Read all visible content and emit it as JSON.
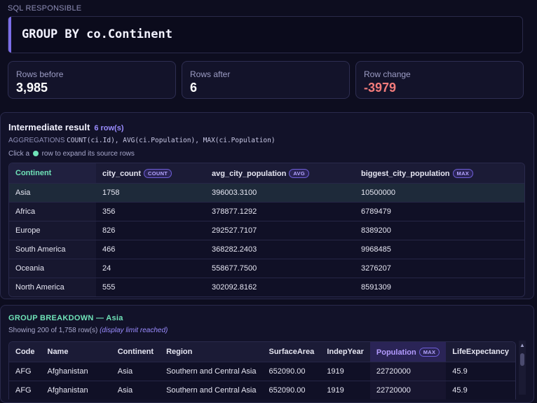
{
  "sql": {
    "label": "SQL RESPONSIBLE",
    "clause": "GROUP BY co.Continent"
  },
  "stats": [
    {
      "label": "Rows before",
      "value": "3,985"
    },
    {
      "label": "Rows after",
      "value": "6"
    },
    {
      "label": "Row change",
      "value": "-3979"
    }
  ],
  "intermediate": {
    "title": "Intermediate result",
    "count": "6 row(s)",
    "agg_label": "AGGREGATIONS",
    "agg_code": "COUNT(ci.Id), AVG(ci.Population), MAX(ci.Population)",
    "hint_pre": "Click a",
    "hint_post": "row to expand its source rows",
    "columns": [
      {
        "name": "Continent",
        "tag": ""
      },
      {
        "name": "city_count",
        "tag": "COUNT"
      },
      {
        "name": "avg_city_population",
        "tag": "AVG"
      },
      {
        "name": "biggest_city_population",
        "tag": "MAX"
      }
    ],
    "rows": [
      [
        "Asia",
        "1758",
        "396003.3100",
        "10500000"
      ],
      [
        "Africa",
        "356",
        "378877.1292",
        "6789479"
      ],
      [
        "Europe",
        "826",
        "292527.7107",
        "8389200"
      ],
      [
        "South America",
        "466",
        "368282.2403",
        "9968485"
      ],
      [
        "Oceania",
        "24",
        "558677.7500",
        "3276207"
      ],
      [
        "North America",
        "555",
        "302092.8162",
        "8591309"
      ]
    ]
  },
  "breakdown": {
    "title": "GROUP BREAKDOWN — Asia",
    "sub": "Showing 200 of 1,758 row(s)",
    "limit": "(display limit reached)",
    "columns": [
      {
        "name": "Code",
        "tag": ""
      },
      {
        "name": "Name",
        "tag": ""
      },
      {
        "name": "Continent",
        "tag": ""
      },
      {
        "name": "Region",
        "tag": ""
      },
      {
        "name": "SurfaceArea",
        "tag": ""
      },
      {
        "name": "IndepYear",
        "tag": ""
      },
      {
        "name": "Population",
        "tag": "MAX"
      },
      {
        "name": "LifeExpectancy",
        "tag": ""
      }
    ],
    "rows": [
      [
        "AFG",
        "Afghanistan",
        "Asia",
        "Southern and Central Asia",
        "652090.00",
        "1919",
        "22720000",
        "45.9"
      ],
      [
        "AFG",
        "Afghanistan",
        "Asia",
        "Southern and Central Asia",
        "652090.00",
        "1919",
        "22720000",
        "45.9"
      ]
    ]
  },
  "colors": {
    "accent": "#7b6ee8",
    "key": "#6fe3b8",
    "negative": "#f27b7b"
  }
}
